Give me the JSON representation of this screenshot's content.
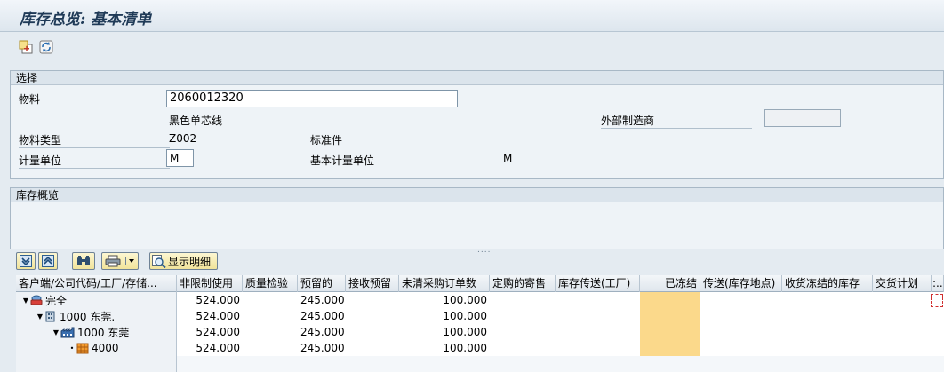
{
  "window": {
    "title": "库存总览: 基本清单"
  },
  "toolbar": {
    "icons": [
      "new-window-icon",
      "refresh-icon"
    ]
  },
  "selection": {
    "header": "选择",
    "material_label": "物料",
    "material_value": "2060012320",
    "material_desc": "黑色单芯线",
    "ext_mfr_label": "外部制造商",
    "ext_mfr_value": "",
    "material_type_label": "物料类型",
    "material_type_code": "Z002",
    "material_type_desc": "标准件",
    "uom_label": "计量单位",
    "uom_value": "M",
    "base_uom_label": "基本计量单位",
    "base_uom_value": "M"
  },
  "stock_overview": {
    "header": "库存概览",
    "splitter": "....",
    "alv_toolbar": {
      "show_details_label": "显示明细"
    },
    "columns": [
      "客户端/公司代码/工厂/存储...",
      "非限制使用",
      "质量检验",
      "预留的",
      "接收预留",
      "未清采购订单数",
      "定购的寄售",
      "库存传送(工厂)",
      "已冻结",
      "传送(库存地点)",
      "收货冻结的库存",
      "交货计划",
      ":.."
    ],
    "rows": [
      {
        "label": "完全",
        "icon": "client-icon",
        "level": 0,
        "unrestricted": "524.000",
        "reserved": "245.000",
        "open_po": "100.000"
      },
      {
        "label": "1000 东莞.",
        "icon": "company-code-icon",
        "level": 1,
        "unrestricted": "524.000",
        "reserved": "245.000",
        "open_po": "100.000"
      },
      {
        "label": "1000 东莞",
        "icon": "plant-icon",
        "level": 2,
        "unrestricted": "524.000",
        "reserved": "245.000",
        "open_po": "100.000"
      },
      {
        "label": "4000",
        "icon": "storage-location-icon",
        "level": 3,
        "unrestricted": "524.000",
        "reserved": "245.000",
        "open_po": "100.000"
      }
    ]
  },
  "colors": {
    "frozen_column": "#fbd98b",
    "title_text": "#1f3a57",
    "background": "#e4ebf1"
  }
}
